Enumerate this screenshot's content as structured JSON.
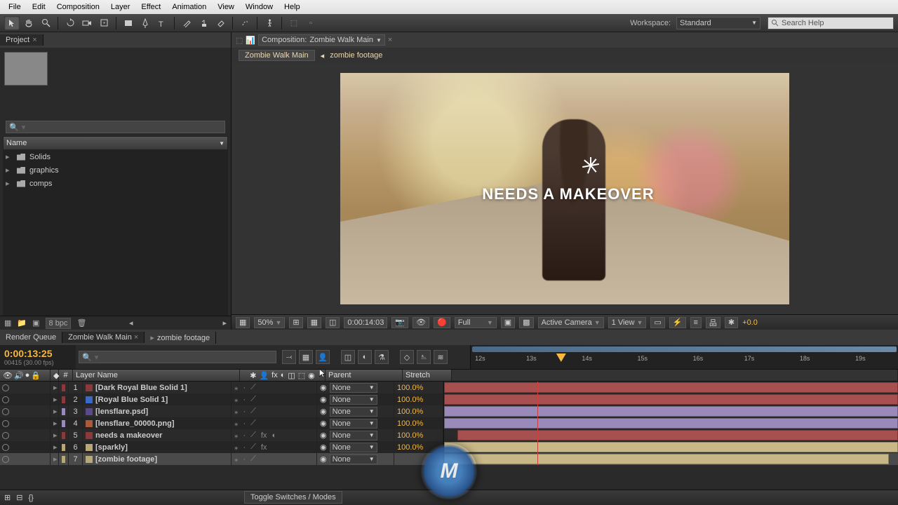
{
  "menu": [
    "File",
    "Edit",
    "Composition",
    "Layer",
    "Effect",
    "Animation",
    "View",
    "Window",
    "Help"
  ],
  "workspace": {
    "label": "Workspace:",
    "value": "Standard"
  },
  "search_help": "Search Help",
  "project": {
    "title": "Project",
    "name_col": "Name",
    "items": [
      "Solids",
      "graphics",
      "comps"
    ],
    "bpc": "8 bpc"
  },
  "comp": {
    "crumb_label": "Composition:",
    "crumb_name": "Zombie Walk Main",
    "flow_main": "Zombie Walk Main",
    "flow_sub": "zombie footage",
    "overlay": "NEEDS A MAKEOVER",
    "zoom": "50%",
    "time": "0:00:14:03",
    "res": "Full",
    "camera": "Active Camera",
    "view": "1 View",
    "exposure": "+0.0"
  },
  "timeline": {
    "tabs": [
      "Render Queue",
      "Zombie Walk Main",
      "zombie footage"
    ],
    "timecode": "0:00:13:25",
    "sub": "00415 (30.00 fps)",
    "cols": {
      "num": "#",
      "name": "Layer Name",
      "parent": "Parent",
      "stretch": "Stretch"
    },
    "ruler": [
      "12s",
      "13s",
      "14s",
      "15s",
      "16s",
      "17s",
      "18s",
      "19s"
    ],
    "layers": [
      {
        "n": "1",
        "name": "[Dark Royal Blue Solid 1]",
        "color": "#8a3a3a",
        "chip": "#8a3a3a",
        "bar": "#a85050",
        "parent": "None",
        "stretch": "100.0%",
        "start": 0,
        "end": 100
      },
      {
        "n": "2",
        "name": "[Royal Blue Solid 1]",
        "color": "#8a3a3a",
        "chip": "#3a6ac8",
        "bar": "#a85050",
        "parent": "None",
        "stretch": "100.0%",
        "start": 0,
        "end": 100
      },
      {
        "n": "3",
        "name": "[lensflare.psd]",
        "color": "#9a8aba",
        "chip": "#5a4a8a",
        "bar": "#9a8aba",
        "parent": "None",
        "stretch": "100.0%",
        "start": 0,
        "end": 100
      },
      {
        "n": "4",
        "name": "[lensflare_00000.png]",
        "color": "#9a8aba",
        "chip": "#aa5a3a",
        "bar": "#9a8aba",
        "parent": "None",
        "stretch": "100.0%",
        "start": 0,
        "end": 100
      },
      {
        "n": "5",
        "name": "needs a makeover",
        "color": "#8a3a3a",
        "chip": "#8a3a3a",
        "bar": "#a85050",
        "parent": "None",
        "stretch": "100.0%",
        "start": 3,
        "end": 100
      },
      {
        "n": "6",
        "name": "[sparkly]",
        "color": "#b8a878",
        "chip": "#b8a878",
        "bar": "#c8b888",
        "parent": "None",
        "stretch": "100.0%",
        "start": 0,
        "end": 100
      },
      {
        "n": "7",
        "name": "[zombie footage]",
        "color": "#b8a878",
        "chip": "#b8a878",
        "bar": "#c8b888",
        "parent": "None",
        "stretch": "",
        "start": 0,
        "end": 98,
        "sel": true
      }
    ],
    "toggle": "Toggle Switches / Modes"
  }
}
